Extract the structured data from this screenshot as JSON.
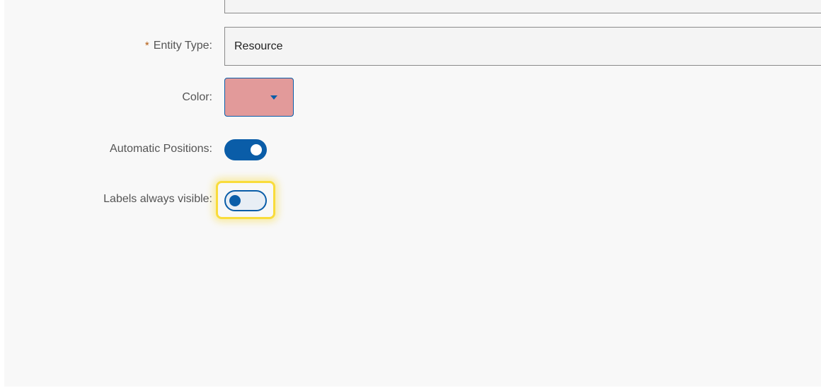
{
  "form": {
    "entity_type": {
      "required_mark": "*",
      "label": "Entity Type:",
      "value": "Resource"
    },
    "color": {
      "label": "Color:",
      "value": "#e29a9a",
      "icon": "caret-down-icon"
    },
    "automatic_positions": {
      "label": "Automatic Positions:",
      "checked": true
    },
    "labels_always_visible": {
      "label": "Labels always visible:",
      "checked": false,
      "focused": true
    }
  },
  "colors": {
    "accent": "#0a5da8",
    "required": "#b35c12",
    "focus": "#f9dc3b",
    "panel_bg": "#f8f8f8"
  }
}
